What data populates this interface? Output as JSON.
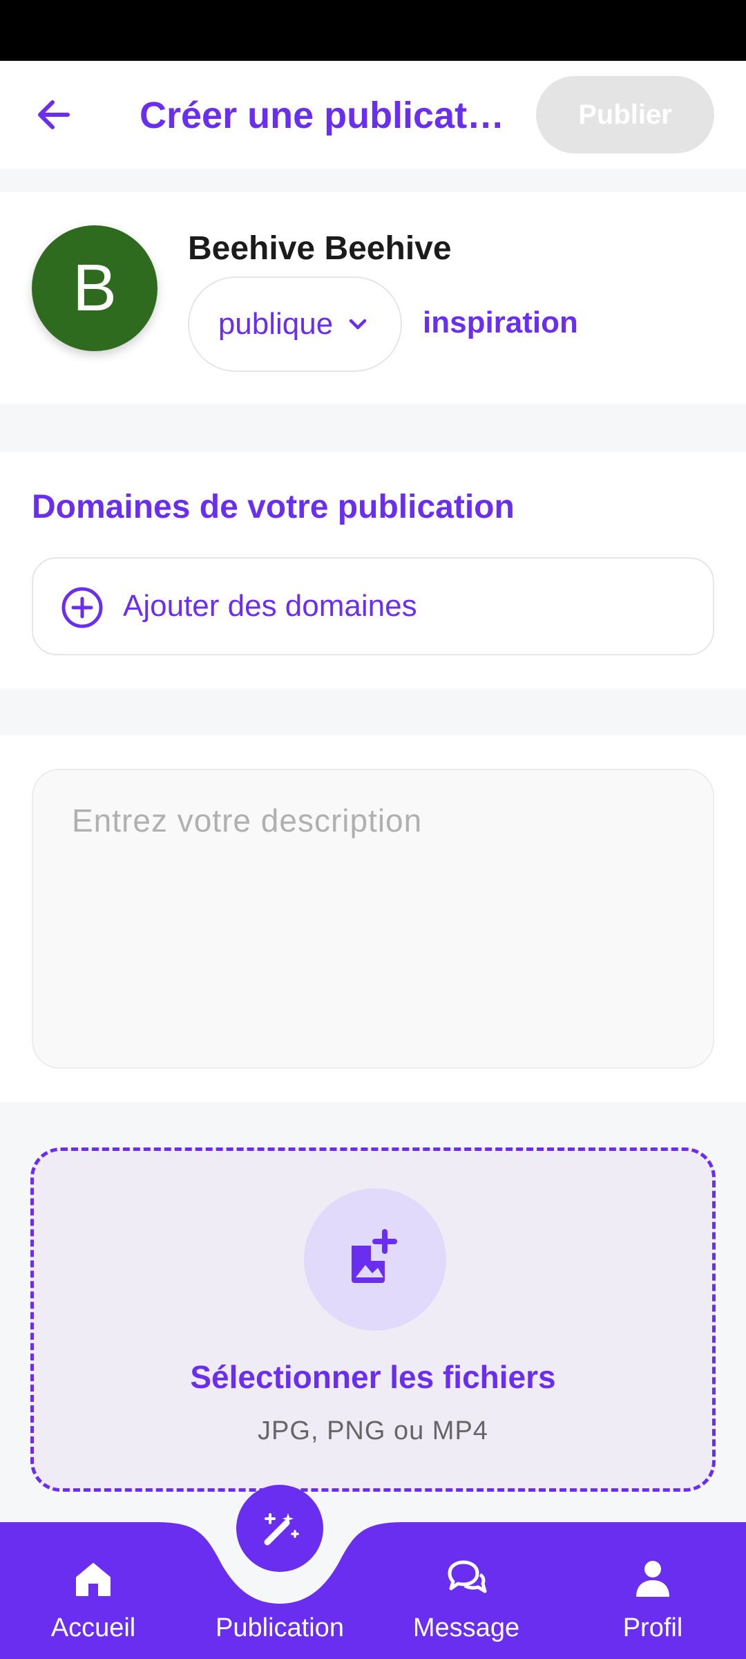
{
  "header": {
    "title": "Créer une publication",
    "publish_label": "Publier"
  },
  "author": {
    "avatar_letter": "B",
    "avatar_color": "#2f6b1f",
    "name": "Beehive Beehive",
    "visibility_value": "publique",
    "inspiration_label": "inspiration"
  },
  "domains": {
    "title": "Domaines de votre publication",
    "add_label": "Ajouter des domaines"
  },
  "description": {
    "placeholder": "Entrez votre description",
    "value": ""
  },
  "upload": {
    "title": "Sélectionner les fichiers",
    "formats": "JPG, PNG ou MP4"
  },
  "nav": {
    "items": [
      {
        "label": "Accueil",
        "icon": "home-icon"
      },
      {
        "label": "Publication",
        "icon": "magic-wand-icon"
      },
      {
        "label": "Message",
        "icon": "chat-icon"
      },
      {
        "label": "Profil",
        "icon": "person-icon"
      }
    ]
  },
  "colors": {
    "accent": "#6a2ef0",
    "publish_disabled_bg": "#e4e4e4",
    "upload_bg": "#efecf6"
  }
}
